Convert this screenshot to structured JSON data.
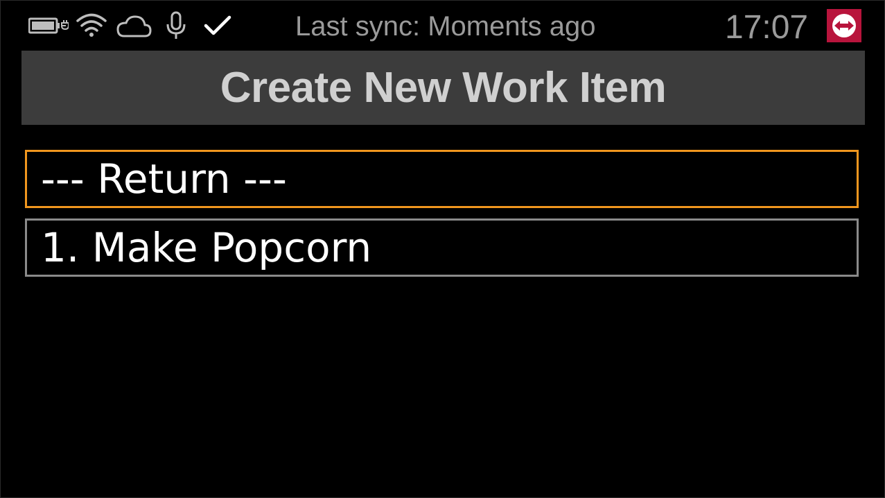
{
  "status_bar": {
    "icons": [
      "battery-charging-icon",
      "wifi-icon",
      "cloud-icon",
      "microphone-icon",
      "checkmark-icon"
    ],
    "sync_text": "Last sync: Moments ago",
    "time": "17:07",
    "app_icon": "teamviewer-icon"
  },
  "header": {
    "title": "Create New Work Item"
  },
  "menu": {
    "items": [
      {
        "label": "--- Return ---",
        "selected": true
      },
      {
        "label": "1. Make Popcorn",
        "selected": false
      }
    ]
  },
  "colors": {
    "background": "#000000",
    "header_bg": "#3c3c3c",
    "header_text": "#d0d0d0",
    "status_text": "#9a9a9a",
    "selected_border": "#f0961e",
    "item_border": "#8a8a8a",
    "item_text": "#ffffff",
    "app_icon_bg": "#b8143c"
  }
}
